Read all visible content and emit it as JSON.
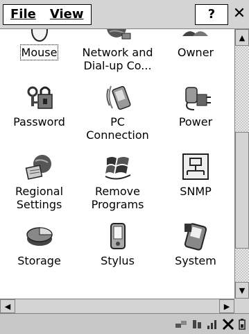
{
  "menu": {
    "file_label": "File",
    "view_label": "View",
    "help_label": "?",
    "close_label": "✕"
  },
  "items": [
    {
      "label": "Mouse",
      "icon": "mouse-icon",
      "selected": true
    },
    {
      "label": "Network and\nDial-up Co...",
      "icon": "network-globe-icon"
    },
    {
      "label": "Owner",
      "icon": "owner-people-icon"
    },
    {
      "label": "Password",
      "icon": "keys-lock-icon"
    },
    {
      "label": "PC\nConnection",
      "icon": "pc-connection-icon"
    },
    {
      "label": "Power",
      "icon": "power-plug-icon"
    },
    {
      "label": "Regional\nSettings",
      "icon": "globe-calendar-icon"
    },
    {
      "label": "Remove\nPrograms",
      "icon": "windows-remove-icon"
    },
    {
      "label": "SNMP",
      "icon": "snmp-network-icon"
    },
    {
      "label": "Storage",
      "icon": "storage-pie-icon"
    },
    {
      "label": "Stylus",
      "icon": "stylus-pda-icon"
    },
    {
      "label": "System",
      "icon": "system-handheld-icon"
    }
  ],
  "scrollbars": {
    "up_arrow": "▲",
    "down_arrow": "▼",
    "left_arrow": "◀",
    "right_arrow": "▶"
  },
  "taskbar": {
    "tray_icons": [
      "network-status-icon",
      "connection-icon",
      "signal-icon",
      "no-sync-icon",
      "battery-icon"
    ]
  }
}
